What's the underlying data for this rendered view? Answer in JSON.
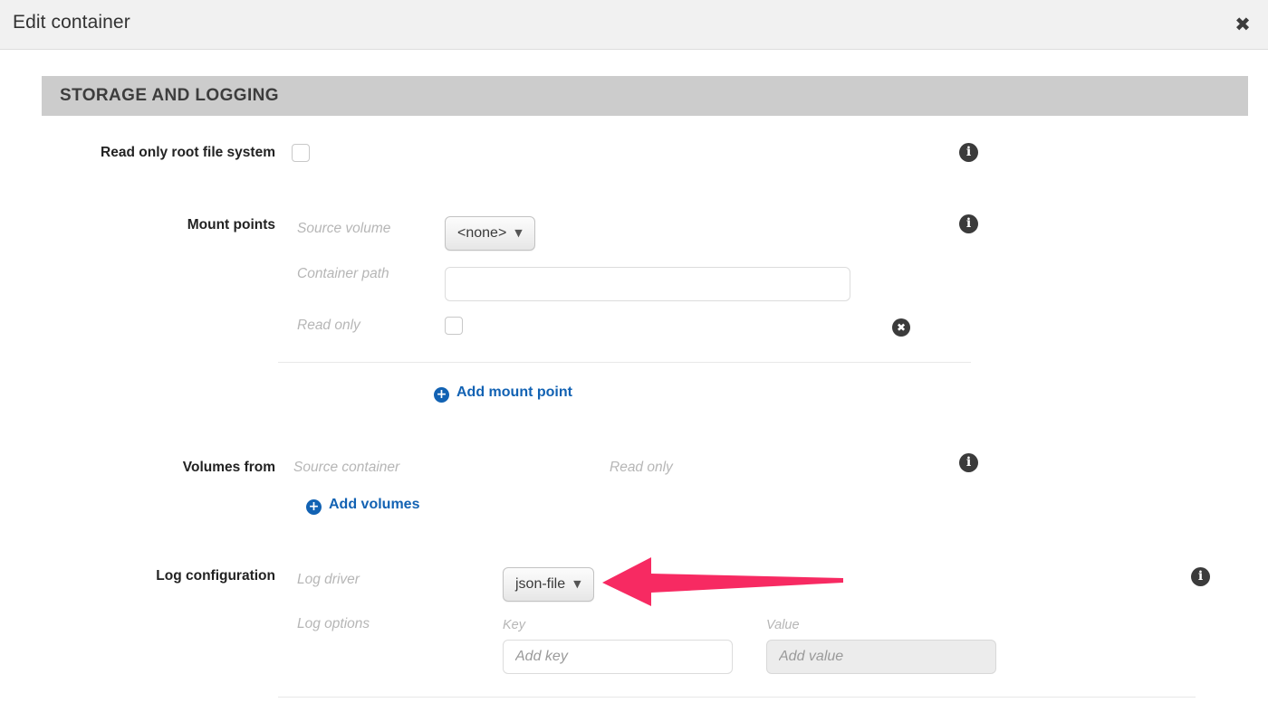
{
  "window": {
    "title": "Edit container",
    "close_icon": "close-icon"
  },
  "section": {
    "title": "STORAGE AND LOGGING"
  },
  "rows": {
    "read_only_root": {
      "label": "Read only root file system",
      "checked": false,
      "info_icon": "info-icon"
    },
    "mount_points": {
      "label": "Mount points",
      "source_volume": {
        "label": "Source volume",
        "selected": "<none>",
        "options": [
          "<none>"
        ]
      },
      "container_path": {
        "label": "Container path",
        "value": "",
        "placeholder": ""
      },
      "read_only": {
        "label": "Read only",
        "checked": false
      },
      "remove_icon": "remove-icon",
      "add_link": "Add mount point",
      "info_icon": "info-icon"
    },
    "volumes_from": {
      "label": "Volumes from",
      "source_container_header": "Source container",
      "read_only_header": "Read only",
      "add_link": "Add volumes",
      "info_icon": "info-icon"
    },
    "log_configuration": {
      "label": "Log configuration",
      "log_driver": {
        "label": "Log driver",
        "selected": "json-file",
        "options": [
          "json-file"
        ]
      },
      "log_options": {
        "label": "Log options",
        "key_header": "Key",
        "value_header": "Value",
        "key_placeholder": "Add key",
        "value_placeholder": "Add value"
      },
      "info_icon": "info-icon"
    }
  },
  "annotation": {
    "arrow_color": "#f72a62",
    "points_to": "log-driver-dropdown"
  },
  "colors": {
    "link": "#1262b3",
    "section_band": "#cccccc",
    "header_bg": "#f1f1f1",
    "accent_pink": "#f72a62"
  }
}
